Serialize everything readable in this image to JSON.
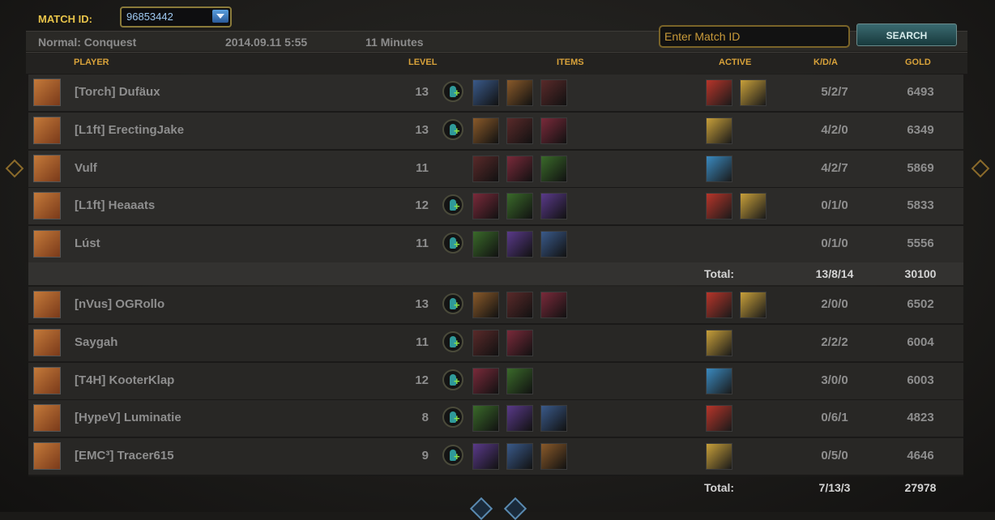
{
  "match": {
    "id_label": "MATCH ID:",
    "id_value": "96853442",
    "mode": "Normal: Conquest",
    "date": "2014.09.11  5:55",
    "duration": "11 Minutes"
  },
  "search": {
    "placeholder": "Enter Match ID",
    "button_label": "SEARCH"
  },
  "columns": {
    "player": "PLAYER",
    "level": "LEVEL",
    "items": "ITEMS",
    "active": "ACTIVE",
    "kda": "K/D/A",
    "gold": "GOLD"
  },
  "teams": [
    {
      "players": [
        {
          "name": "[Torch] Dufäux",
          "level": "13",
          "kda": "5/2/7",
          "gold": "6493",
          "portrait": "god-portrait",
          "items": [
            "item-icon",
            "item-icon",
            "item-icon"
          ],
          "actives": [
            "active-icon",
            "active-icon"
          ]
        },
        {
          "name": "[L1ft] ErectingJake",
          "level": "13",
          "kda": "4/2/0",
          "gold": "6349",
          "portrait": "god-portrait",
          "items": [
            "item-icon",
            "item-icon",
            "item-icon"
          ],
          "actives": [
            "active-icon"
          ]
        },
        {
          "name": "Vulf",
          "level": "11",
          "kda": "4/2/7",
          "gold": "5869",
          "portrait": "god-portrait",
          "items": [
            "item-icon",
            "item-icon",
            "item-icon"
          ],
          "actives": [
            "active-icon"
          ]
        },
        {
          "name": "[L1ft] Heaaats",
          "level": "12",
          "kda": "0/1/0",
          "gold": "5833",
          "portrait": "god-portrait",
          "items": [
            "item-icon",
            "item-icon",
            "item-icon"
          ],
          "actives": [
            "active-icon",
            "active-icon"
          ]
        },
        {
          "name": "Lúst",
          "level": "11",
          "kda": "0/1/0",
          "gold": "5556",
          "portrait": "god-portrait",
          "items": [
            "item-icon",
            "item-icon",
            "item-icon"
          ],
          "actives": []
        }
      ],
      "total_label": "Total:",
      "total_kda": "13/8/14",
      "total_gold": "30100"
    },
    {
      "players": [
        {
          "name": "[nVus] OGRollo",
          "level": "13",
          "kda": "2/0/0",
          "gold": "6502",
          "portrait": "god-portrait",
          "items": [
            "item-icon",
            "item-icon",
            "item-icon"
          ],
          "actives": [
            "active-icon",
            "active-icon"
          ]
        },
        {
          "name": "Saygah",
          "level": "11",
          "kda": "2/2/2",
          "gold": "6004",
          "portrait": "god-portrait",
          "items": [
            "item-icon",
            "item-icon"
          ],
          "actives": [
            "active-icon"
          ]
        },
        {
          "name": "[T4H] KooterKlap",
          "level": "12",
          "kda": "3/0/0",
          "gold": "6003",
          "portrait": "god-portrait",
          "items": [
            "item-icon",
            "item-icon"
          ],
          "actives": [
            "active-icon"
          ]
        },
        {
          "name": "[HypeV] Luminatie",
          "level": "8",
          "kda": "0/6/1",
          "gold": "4823",
          "portrait": "god-portrait",
          "items": [
            "item-icon",
            "item-icon",
            "item-icon"
          ],
          "actives": [
            "active-icon"
          ]
        },
        {
          "name": "[EMC³] Tracer615",
          "level": "9",
          "kda": "0/5/0",
          "gold": "4646",
          "portrait": "god-portrait",
          "items": [
            "item-icon",
            "item-icon",
            "item-icon"
          ],
          "actives": [
            "active-icon"
          ]
        }
      ],
      "total_label": "Total:",
      "total_kda": "7/13/3",
      "total_gold": "27978"
    }
  ],
  "colors": {
    "accent_gold": "#d8a23a",
    "frame_gold": "#8a6a2a"
  }
}
